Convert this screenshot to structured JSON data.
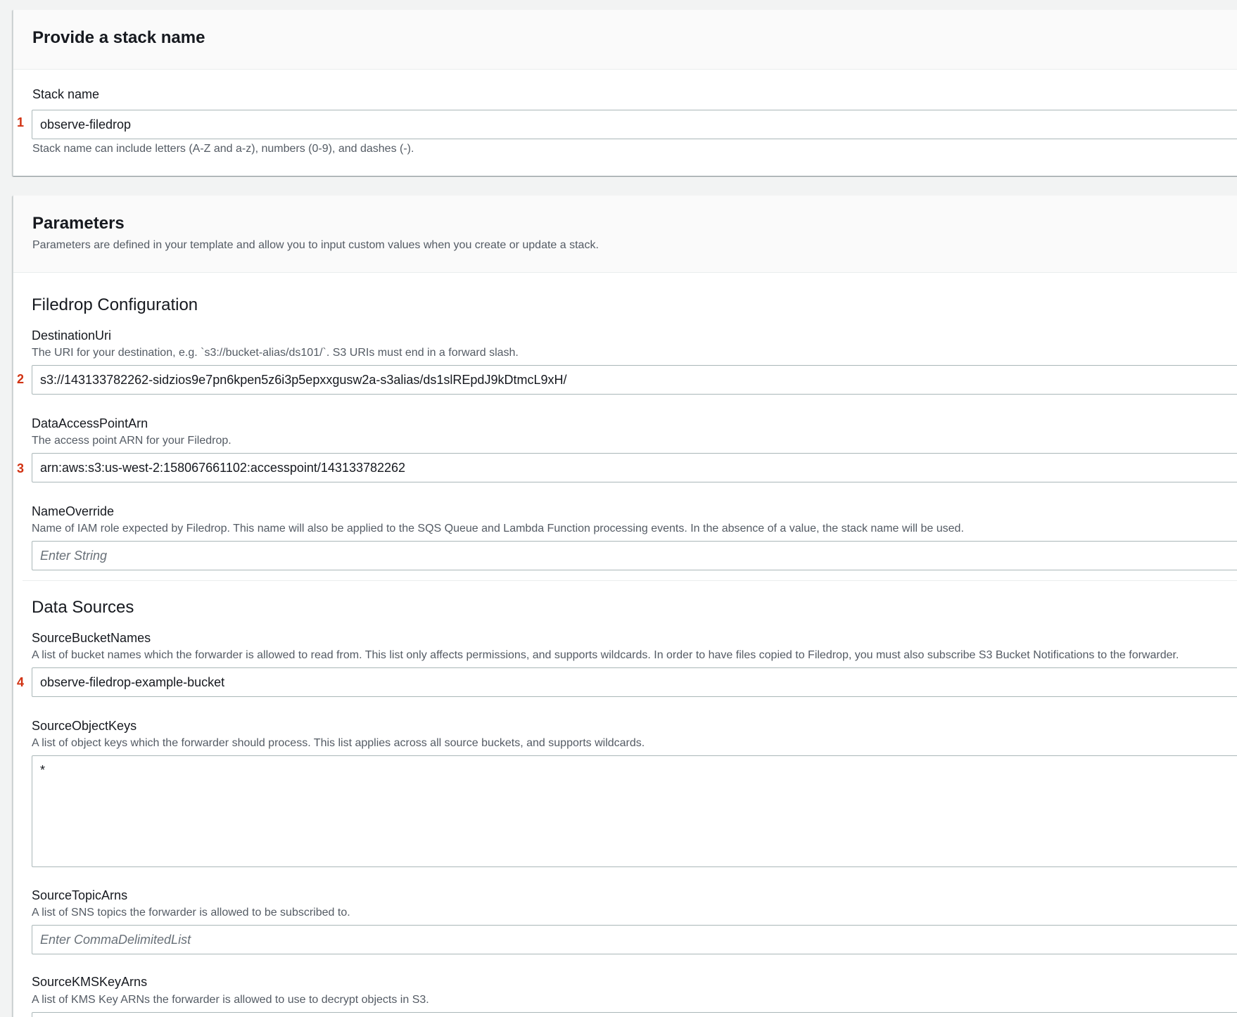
{
  "stack_name_panel": {
    "title": "Provide a stack name",
    "field_label": "Stack name",
    "field_value": "observe-filedrop",
    "hint": "Stack name can include letters (A-Z and a-z), numbers (0-9), and dashes (-).",
    "marker": "1"
  },
  "parameters_panel": {
    "title": "Parameters",
    "description": "Parameters are defined in your template and allow you to input custom values when you create or update a stack.",
    "filedrop_section": {
      "title": "Filedrop Configuration",
      "destination_uri": {
        "label": "DestinationUri",
        "description": "The URI for your destination, e.g. `s3://bucket-alias/ds101/`. S3 URIs must end in a forward slash.",
        "value": "s3://143133782262-sidzios9e7pn6kpen5z6i3p5epxxgusw2a-s3alias/ds1slREpdJ9kDtmcL9xH/",
        "marker": "2"
      },
      "data_access_point_arn": {
        "label": "DataAccessPointArn",
        "description": "The access point ARN for your Filedrop.",
        "value": "arn:aws:s3:us-west-2:158067661102:accesspoint/143133782262",
        "marker": "3"
      },
      "name_override": {
        "label": "NameOverride",
        "description": "Name of IAM role expected by Filedrop. This name will also be applied to the SQS Queue and Lambda Function processing events. In the absence of a value, the stack name will be used.",
        "placeholder": "Enter String"
      }
    },
    "data_sources_section": {
      "title": "Data Sources",
      "source_bucket_names": {
        "label": "SourceBucketNames",
        "description": "A list of bucket names which the forwarder is allowed to read from. This list only affects permissions, and supports wildcards. In order to have files copied to Filedrop, you must also subscribe S3 Bucket Notifications to the forwarder.",
        "value": "observe-filedrop-example-bucket",
        "marker": "4"
      },
      "source_object_keys": {
        "label": "SourceObjectKeys",
        "description": "A list of object keys which the forwarder should process. This list applies across all source buckets, and supports wildcards.",
        "value": "*"
      },
      "source_topic_arns": {
        "label": "SourceTopicArns",
        "description": "A list of SNS topics the forwarder is allowed to be subscribed to.",
        "placeholder": "Enter CommaDelimitedList"
      },
      "source_kms_key_arns": {
        "label": "SourceKMSKeyArns",
        "description": "A list of KMS Key ARNs the forwarder is allowed to use to decrypt objects in S3."
      }
    }
  }
}
